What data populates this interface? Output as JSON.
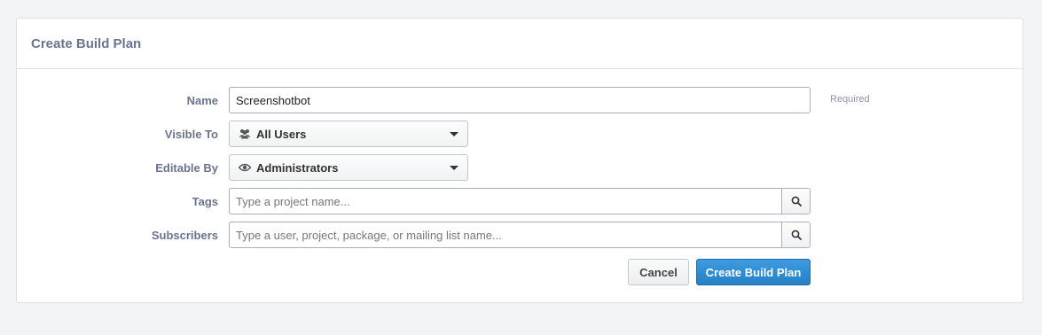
{
  "panel": {
    "title": "Create Build Plan"
  },
  "form": {
    "name": {
      "label": "Name",
      "value": "Screenshotbot",
      "hint": "Required"
    },
    "visible_to": {
      "label": "Visible To",
      "value": "All Users",
      "icon": "users-icon"
    },
    "editable_by": {
      "label": "Editable By",
      "value": "Administrators",
      "icon": "eye-icon"
    },
    "tags": {
      "label": "Tags",
      "placeholder": "Type a project name..."
    },
    "subscribers": {
      "label": "Subscribers",
      "placeholder": "Type a user, project, package, or mailing list name..."
    }
  },
  "actions": {
    "cancel_label": "Cancel",
    "submit_label": "Create Build Plan"
  },
  "colors": {
    "primary": "#2580c6",
    "label": "#6b748c",
    "background": "#f3f4f6"
  }
}
